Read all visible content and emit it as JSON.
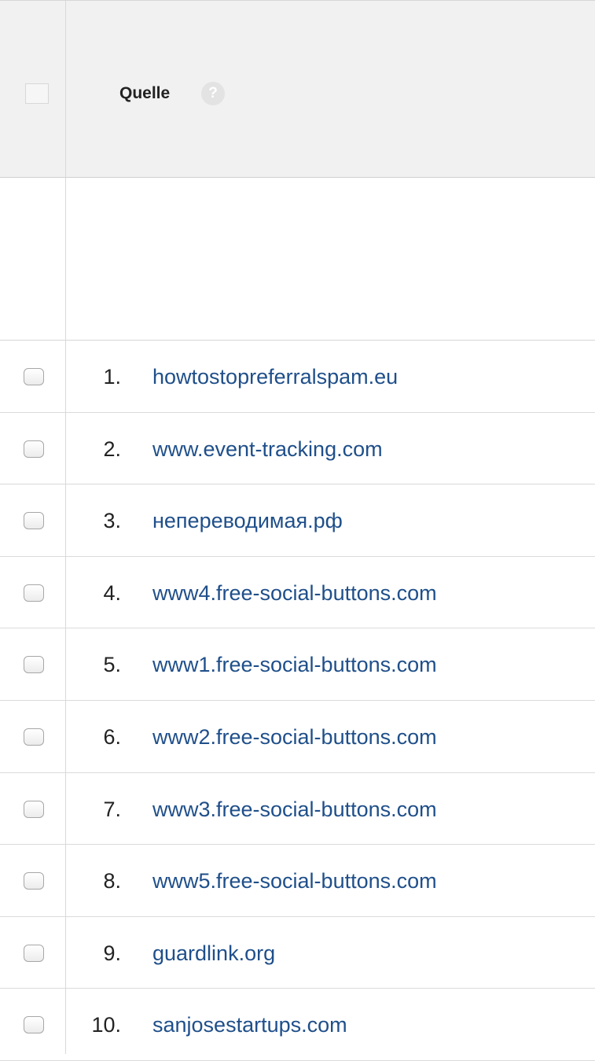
{
  "header": {
    "column_title": "Quelle",
    "help_glyph": "?"
  },
  "rows": [
    {
      "index": "1.",
      "source": "howtostopreferralspam.eu"
    },
    {
      "index": "2.",
      "source": "www.event-tracking.com"
    },
    {
      "index": "3.",
      "source": "непереводимая.рф"
    },
    {
      "index": "4.",
      "source": "www4.free-social-buttons.com"
    },
    {
      "index": "5.",
      "source": "www1.free-social-buttons.com"
    },
    {
      "index": "6.",
      "source": "www2.free-social-buttons.com"
    },
    {
      "index": "7.",
      "source": "www3.free-social-buttons.com"
    },
    {
      "index": "8.",
      "source": "www5.free-social-buttons.com"
    },
    {
      "index": "9.",
      "source": "guardlink.org"
    },
    {
      "index": "10.",
      "source": "sanjosestartups.com"
    }
  ],
  "colors": {
    "link": "#1f4f8a",
    "header_bg": "#f1f1f1",
    "text": "#222222"
  },
  "icons": {
    "help": "help-icon",
    "checkbox": "checkbox-icon"
  }
}
